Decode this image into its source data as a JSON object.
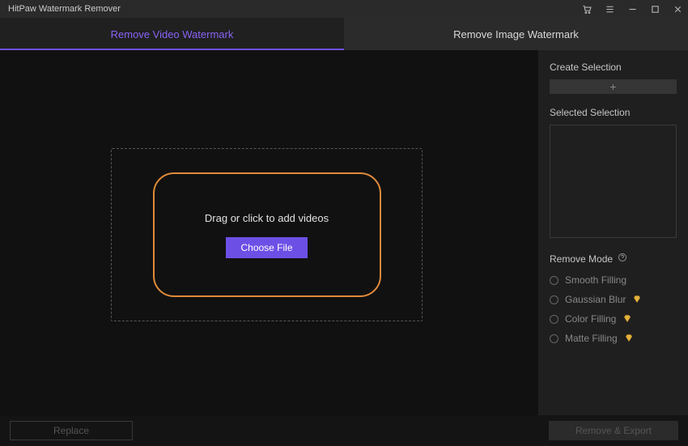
{
  "titlebar": {
    "title": "HitPaw Watermark Remover"
  },
  "tabs": {
    "video": "Remove Video Watermark",
    "image": "Remove Image Watermark"
  },
  "dropzone": {
    "text": "Drag or click to add videos",
    "button": "Choose File"
  },
  "sidebar": {
    "create_label": "Create Selection",
    "create_plus": "+",
    "selected_label": "Selected Selection",
    "mode_label": "Remove Mode",
    "modes": {
      "smooth": "Smooth Filling",
      "gaussian": "Gaussian Blur",
      "color": "Color Filling",
      "matte": "Matte Filling"
    }
  },
  "footer": {
    "replace": "Replace",
    "export": "Remove & Export"
  }
}
